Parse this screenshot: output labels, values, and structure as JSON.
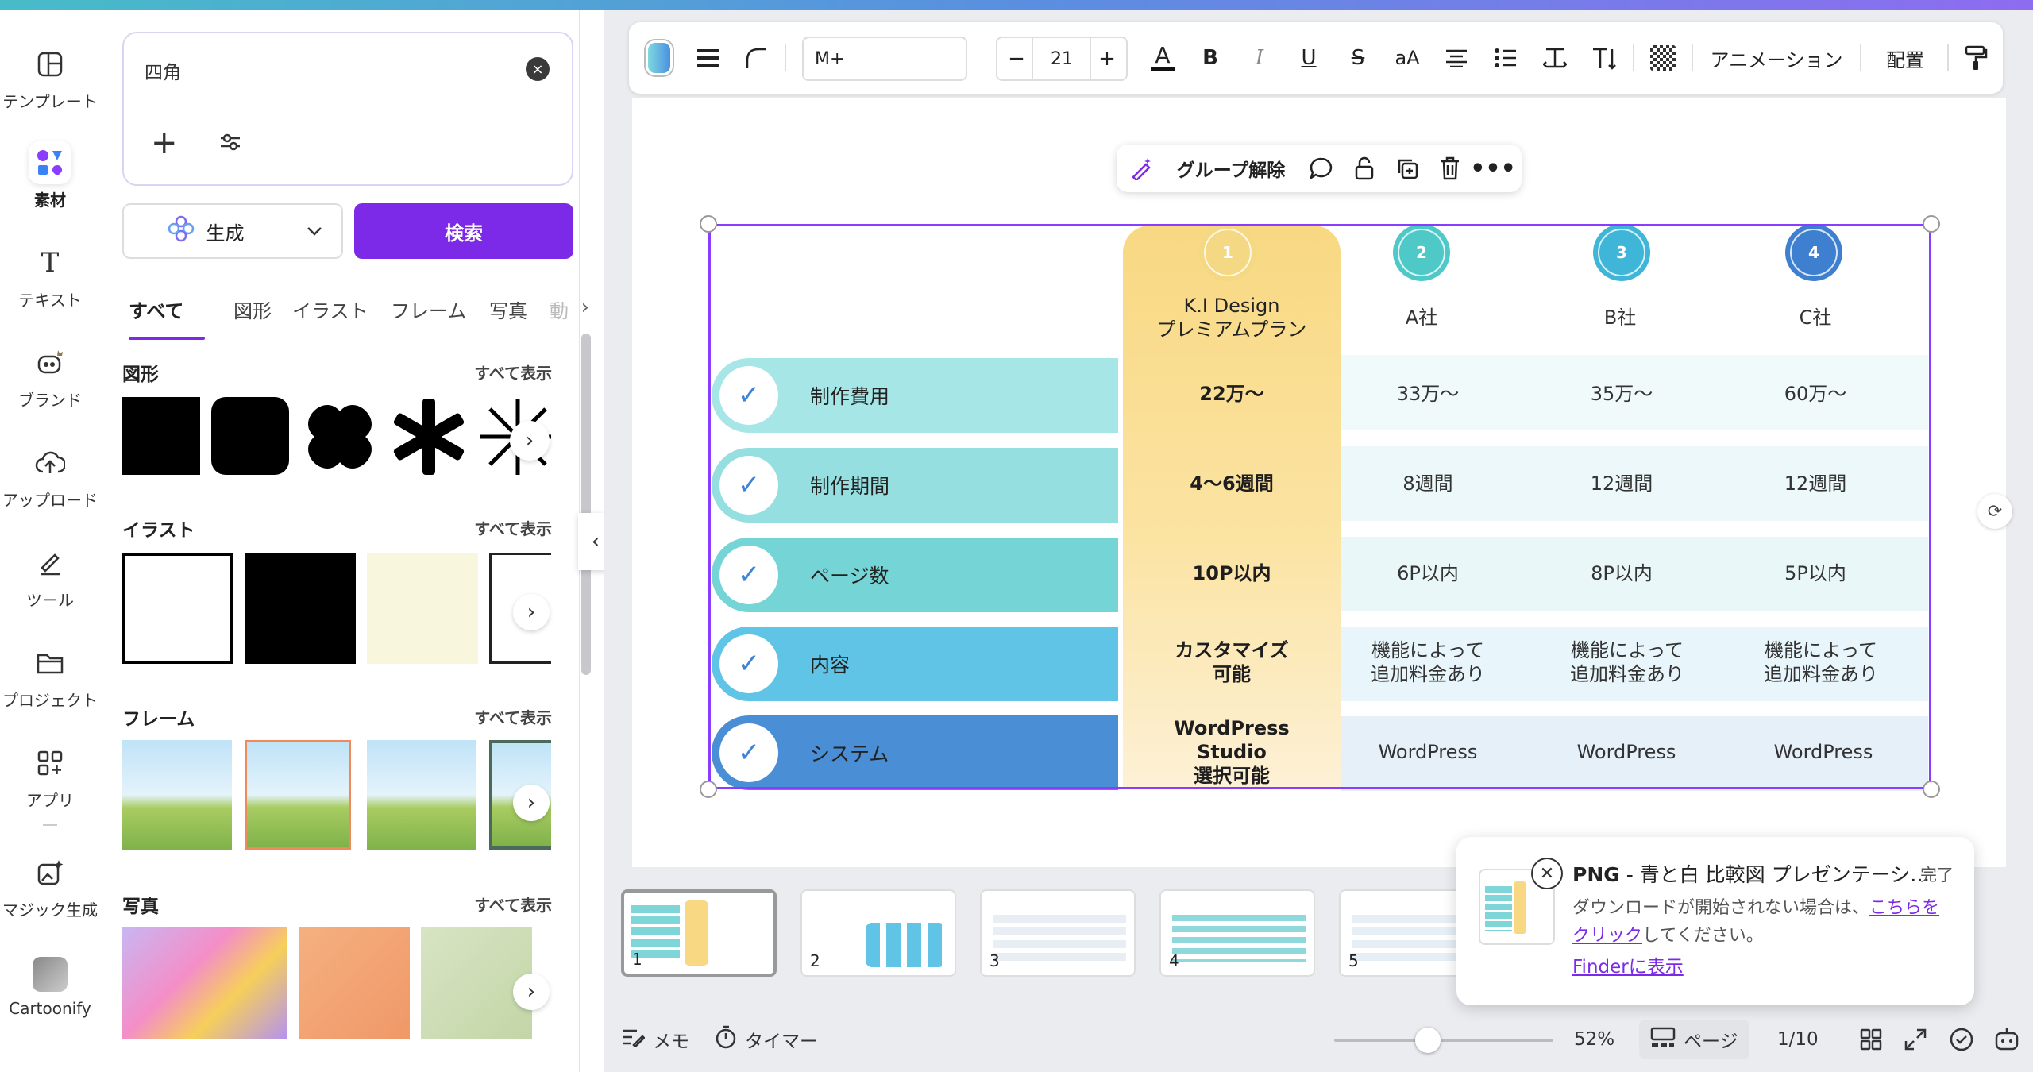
{
  "rail": {
    "items": [
      {
        "label": "テンプレート"
      },
      {
        "label": "素材"
      },
      {
        "label": "テキスト"
      },
      {
        "label": "ブランド"
      },
      {
        "label": "アップロード"
      },
      {
        "label": "ツール"
      },
      {
        "label": "プロジェクト"
      },
      {
        "label": "アプリ"
      },
      {
        "label": "マジック生成"
      },
      {
        "label": "Cartoonify"
      }
    ]
  },
  "panel": {
    "search_value": "四角",
    "generate_label": "生成",
    "search_button": "検索",
    "tabs": [
      "すべて",
      "図形",
      "イラスト",
      "フレーム",
      "写真",
      "動"
    ],
    "sections": {
      "shapes": {
        "title": "図形",
        "more": "すべて表示"
      },
      "illust": {
        "title": "イラスト",
        "more": "すべて表示"
      },
      "frames": {
        "title": "フレーム",
        "more": "すべて表示"
      },
      "photos": {
        "title": "写真",
        "more": "すべて表示"
      }
    }
  },
  "toolbar": {
    "font": "M+",
    "font_size": "21",
    "minus": "−",
    "plus": "+",
    "animation": "アニメーション",
    "arrange": "配置"
  },
  "context_bar": {
    "ungroup": "グループ解除"
  },
  "table": {
    "premium_header": "K.I Design\nプレミアムプラン",
    "columns": [
      {
        "num": "1",
        "name": ""
      },
      {
        "num": "2",
        "name": "A社"
      },
      {
        "num": "3",
        "name": "B社"
      },
      {
        "num": "4",
        "name": "C社"
      }
    ],
    "rows": [
      {
        "label": "制作費用",
        "premium": "22万〜",
        "a": "33万〜",
        "b": "35万〜",
        "c": "60万〜"
      },
      {
        "label": "制作期間",
        "premium": "4〜6週間",
        "a": "8週間",
        "b": "12週間",
        "c": "12週間"
      },
      {
        "label": "ページ数",
        "premium": "10P以内",
        "a": "6P以内",
        "b": "8P以内",
        "c": "5P以内"
      },
      {
        "label": "内容",
        "premium": "カスタマイズ\n可能",
        "a": "機能によって\n追加料金あり",
        "b": "機能によって\n追加料金あり",
        "c": "機能によって\n追加料金あり"
      },
      {
        "label": "システム",
        "premium": "WordPress\nStudio\n選択可能",
        "a": "WordPress",
        "b": "WordPress",
        "c": "WordPress"
      }
    ],
    "colors": {
      "row1": "#a6e6e6",
      "row2": "#95dfe0",
      "row3": "#74d4d6",
      "row4": "#5fc4e6",
      "row5": "#4a8fd6",
      "num2": "#4fc8c8",
      "num3": "#3fb5d8",
      "num4": "#3e7fd0",
      "num1": "#f5cf6a"
    }
  },
  "thumbs": [
    "1",
    "2",
    "3",
    "4",
    "5"
  ],
  "status": {
    "memo": "メモ",
    "timer": "タイマー",
    "zoom": "52%",
    "page_label": "ページ",
    "page_count": "1/10"
  },
  "toast": {
    "format": "PNG",
    "title": " - 青と白 比較図 プレゼンテーシ…",
    "done": "完了",
    "msg_pre": "ダウンロードが開始されない場合は、",
    "msg_link": "こちらをクリック",
    "msg_post": "してください。",
    "finder": "Finderに表示"
  }
}
